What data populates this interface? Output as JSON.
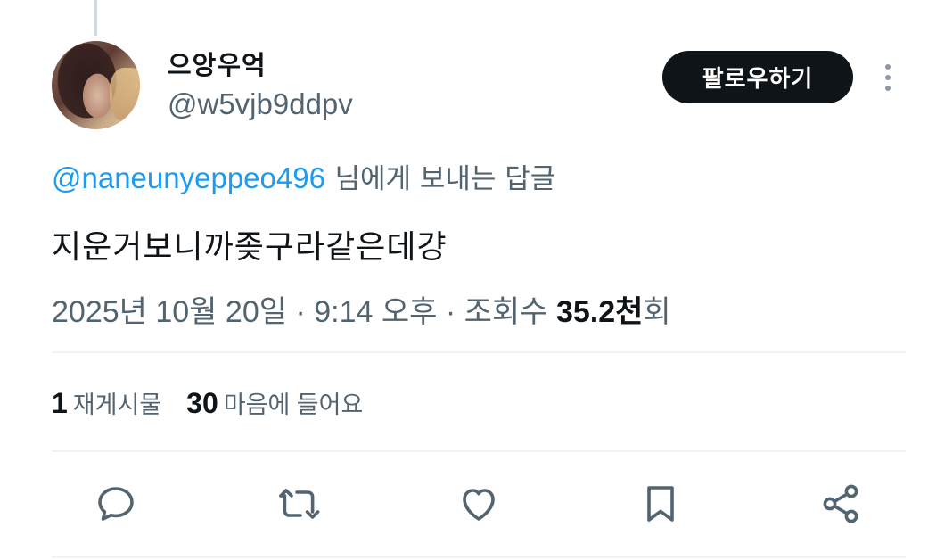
{
  "author": {
    "display_name": "으앙우억",
    "handle": "@w5vjb9ddpv"
  },
  "follow_button": {
    "label": "팔로우하기"
  },
  "reply_to": {
    "mention": "@naneunyeppeo496",
    "suffix": "님에게 보내는 답글"
  },
  "tweet": {
    "text": "지운거보니까좆구라같은데걍"
  },
  "meta": {
    "date": "2025년 10월 20일",
    "separator1": " · ",
    "time": "9:14 오후",
    "separator2": " · ",
    "views_label": "조회수 ",
    "views_count": "35.2천",
    "views_suffix": "회"
  },
  "stats": {
    "reposts_count": "1",
    "reposts_label": "재게시물",
    "likes_count": "30",
    "likes_label": "마음에 들어요"
  },
  "actions": [
    "reply-icon",
    "repost-icon",
    "like-icon",
    "bookmark-icon",
    "share-icon"
  ],
  "colors": {
    "accent": "#1d9bf0",
    "text_primary": "#0f1419",
    "text_secondary": "#536471",
    "button_bg": "#0f1419"
  }
}
